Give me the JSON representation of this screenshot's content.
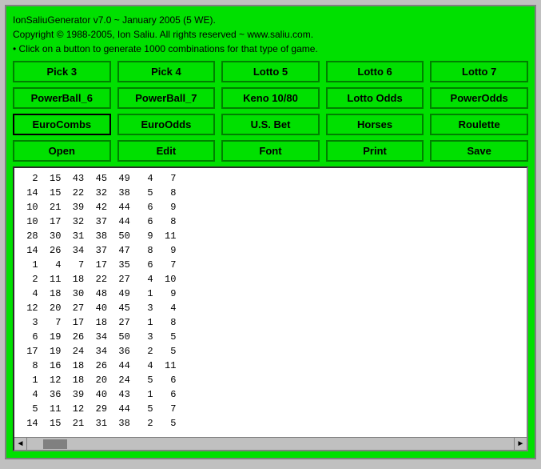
{
  "app": {
    "title_line1": "IonSaliuGenerator v7.0 ~ January 2005 (5 WE).",
    "title_line2": "Copyright © 1988-2005, Ion Saliu. All rights reserved ~ www.saliu.com.",
    "title_line3": "• Click on a button to generate 1000 combinations for that type of game."
  },
  "buttons": {
    "row1": [
      {
        "label": "Pick 3",
        "name": "pick3-button",
        "outlined": false
      },
      {
        "label": "Pick 4",
        "name": "pick4-button",
        "outlined": false
      },
      {
        "label": "Lotto 5",
        "name": "lotto5-button",
        "outlined": false
      },
      {
        "label": "Lotto 6",
        "name": "lotto6-button",
        "outlined": false
      },
      {
        "label": "Lotto 7",
        "name": "lotto7-button",
        "outlined": false
      }
    ],
    "row2": [
      {
        "label": "PowerBall_6",
        "name": "powerball6-button",
        "outlined": false
      },
      {
        "label": "PowerBall_7",
        "name": "powerball7-button",
        "outlined": false
      },
      {
        "label": "Keno 10/80",
        "name": "keno-button",
        "outlined": false
      },
      {
        "label": "Lotto Odds",
        "name": "lotto-odds-button",
        "outlined": false
      },
      {
        "label": "PowerOdds",
        "name": "power-odds-button",
        "outlined": false
      }
    ],
    "row3": [
      {
        "label": "EuroCombs",
        "name": "euro-combs-button",
        "outlined": true
      },
      {
        "label": "EuroOdds",
        "name": "euro-odds-button",
        "outlined": false
      },
      {
        "label": "U.S. Bet",
        "name": "us-bet-button",
        "outlined": false
      },
      {
        "label": "Horses",
        "name": "horses-button",
        "outlined": false
      },
      {
        "label": "Roulette",
        "name": "roulette-button",
        "outlined": false
      }
    ],
    "row4": [
      {
        "label": "Open",
        "name": "open-button",
        "outlined": false
      },
      {
        "label": "Edit",
        "name": "edit-button",
        "outlined": false
      },
      {
        "label": "Font",
        "name": "font-button",
        "outlined": false
      },
      {
        "label": "Print",
        "name": "print-button",
        "outlined": false
      },
      {
        "label": "Save",
        "name": "save-button",
        "outlined": false
      }
    ]
  },
  "output": {
    "lines": [
      "  2  15  43  45  49   4   7",
      " 14  15  22  32  38   5   8",
      " 10  21  39  42  44   6   9",
      " 10  17  32  37  44   6   8",
      " 28  30  31  38  50   9  11",
      " 14  26  34  37  47   8   9",
      "  1   4   7  17  35   6   7",
      "  2  11  18  22  27   4  10",
      "  4  18  30  48  49   1   9",
      " 12  20  27  40  45   3   4",
      "  3   7  17  18  27   1   8",
      "  6  19  26  34  50   3   5",
      " 17  19  24  34  36   2   5",
      "  8  16  18  26  44   4  11",
      "  1  12  18  20  24   5   6",
      "  4  36  39  40  43   1   6",
      "  5  11  12  29  44   5   7",
      " 14  15  21  31  38   2   5"
    ]
  }
}
